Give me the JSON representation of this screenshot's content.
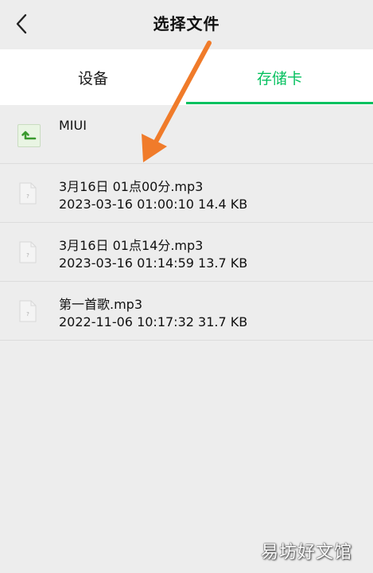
{
  "header": {
    "title": "选择文件",
    "back_icon": "chevron-left-icon"
  },
  "tabs": [
    {
      "label": "设备",
      "active": false
    },
    {
      "label": "存储卡",
      "active": true
    }
  ],
  "accent_color": "#07c160",
  "folder": {
    "name": "MIUI",
    "icon": "folder-up-icon"
  },
  "files": [
    {
      "name": "3月16日 01点00分.mp3",
      "date": "2023-03-16 01:00:10",
      "size": "14.4 KB"
    },
    {
      "name": "3月16日 01点14分.mp3",
      "date": "2023-03-16 01:14:59",
      "size": "13.7 KB"
    },
    {
      "name": "第一首歌.mp3",
      "date": "2022-11-06 10:17:32",
      "size": "31.7 KB"
    }
  ],
  "annotation": {
    "icon": "orange-arrow-icon",
    "color": "#f07b2a"
  },
  "watermark": "易坊好文馆"
}
